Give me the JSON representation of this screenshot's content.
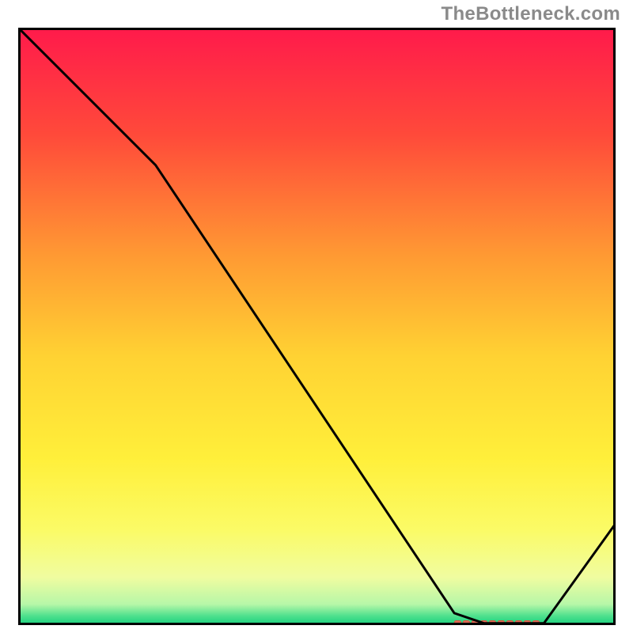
{
  "attribution": "TheBottleneck.com",
  "chart_data": {
    "type": "line",
    "title": "",
    "xlabel": "",
    "ylabel": "",
    "xlim": [
      0,
      100
    ],
    "ylim": [
      0,
      100
    ],
    "x": [
      0,
      23,
      73,
      78,
      88,
      100
    ],
    "values": [
      100,
      77,
      2,
      0.3,
      0.3,
      17
    ],
    "marker_region": {
      "x_start": 73,
      "x_end": 88,
      "y": 0.3
    },
    "gradient_stops": [
      {
        "offset": 0.0,
        "color": "#ff1a4b"
      },
      {
        "offset": 0.18,
        "color": "#ff4a3a"
      },
      {
        "offset": 0.38,
        "color": "#ff9933"
      },
      {
        "offset": 0.55,
        "color": "#ffd233"
      },
      {
        "offset": 0.72,
        "color": "#ffef3a"
      },
      {
        "offset": 0.84,
        "color": "#fbfb66"
      },
      {
        "offset": 0.92,
        "color": "#f0fca0"
      },
      {
        "offset": 0.965,
        "color": "#b7f7a8"
      },
      {
        "offset": 0.985,
        "color": "#4de08d"
      },
      {
        "offset": 1.0,
        "color": "#18cf7e"
      }
    ],
    "colors": {
      "line": "#000000",
      "frame": "#000000",
      "marker_stroke": "#d5523f",
      "marker_fill": "#e06a56"
    }
  }
}
